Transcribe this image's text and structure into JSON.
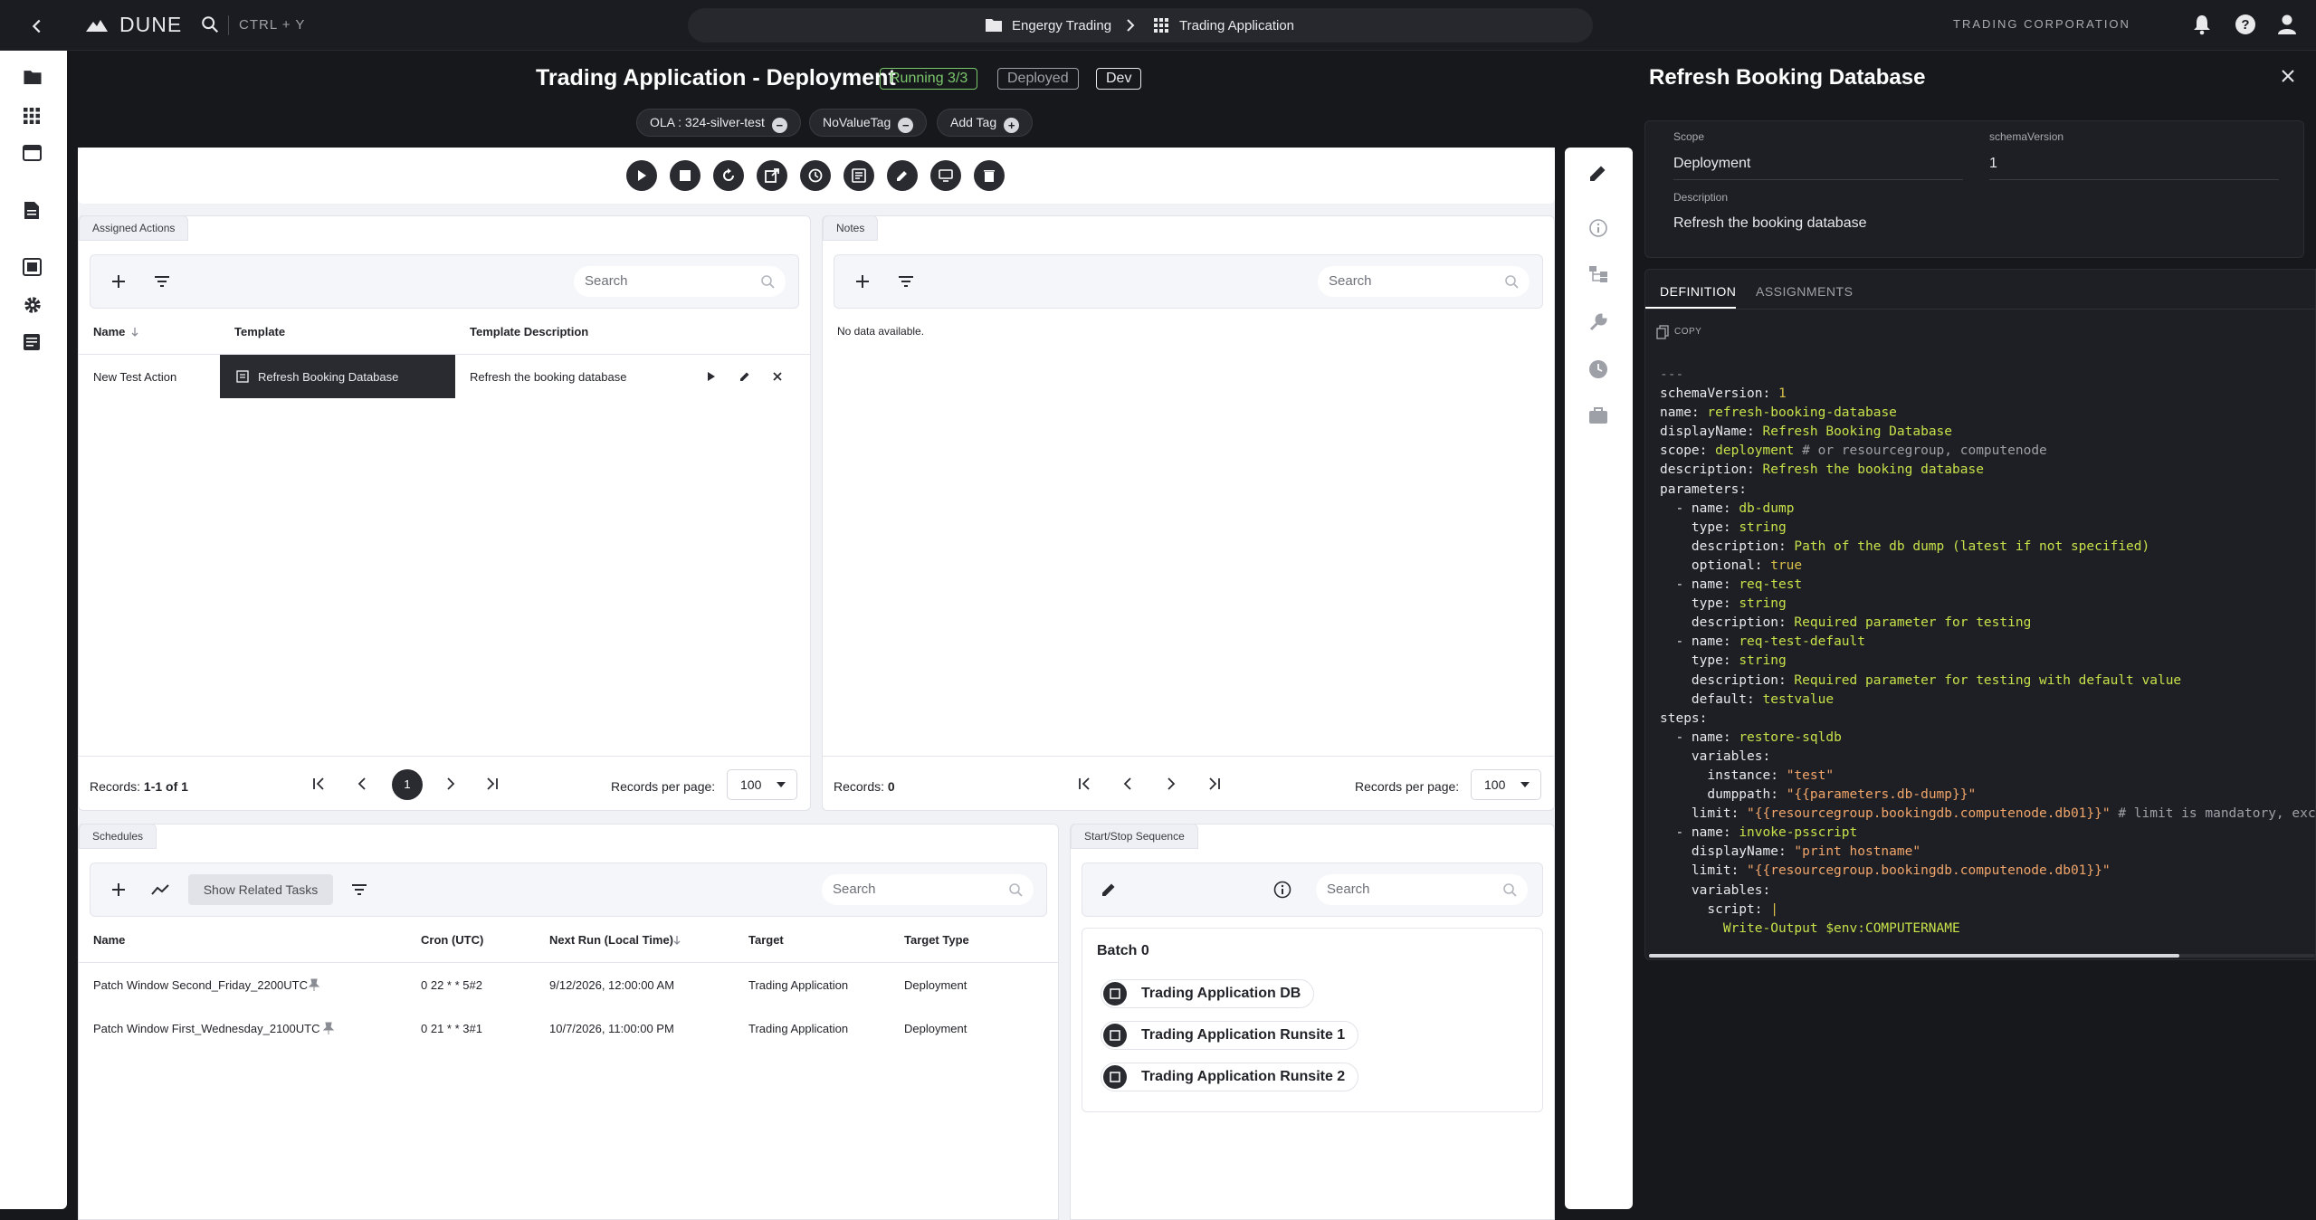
{
  "topbar": {
    "brand": "DUNE",
    "shortcut": "CTRL + Y",
    "breadcrumb": [
      "Engergy Trading",
      "Trading Application"
    ],
    "company": "TRADING CORPORATION"
  },
  "page": {
    "title": "Trading Application - Deployment",
    "badges": {
      "running": "Running 3/3",
      "deployed": "Deployed",
      "env": "Dev"
    },
    "tags": [
      "OLA : 324-silver-test",
      "NoValueTag",
      "Add Tag"
    ]
  },
  "assigned_actions": {
    "tab": "Assigned Actions",
    "search_placeholder": "Search",
    "columns": [
      "Name",
      "Template",
      "Template Description"
    ],
    "rows": [
      {
        "name": "New Test Action",
        "template": "Refresh Booking Database",
        "description": "Refresh the booking database"
      }
    ],
    "records_label": "Records:",
    "records_value": "1-1 of 1",
    "page": "1",
    "per_page_label": "Records per page:",
    "per_page": "100"
  },
  "notes": {
    "tab": "Notes",
    "search_placeholder": "Search",
    "empty": "No data available.",
    "records_label": "Records:",
    "records_value": "0",
    "per_page_label": "Records per page:",
    "per_page": "100"
  },
  "schedules": {
    "tab": "Schedules",
    "related_button": "Show Related Tasks",
    "search_placeholder": "Search",
    "columns": [
      "Name",
      "Cron (UTC)",
      "Next Run (Local Time)",
      "Target",
      "Target Type"
    ],
    "rows": [
      {
        "name": "Patch Window Second_Friday_2200UTC",
        "cron": "0 22 * * 5#2",
        "next": "9/12/2026, 12:00:00 AM",
        "target": "Trading Application",
        "type": "Deployment"
      },
      {
        "name": "Patch Window First_Wednesday_2100UTC",
        "cron": "0 21 * * 3#1",
        "next": "10/7/2026, 11:00:00 PM",
        "target": "Trading Application",
        "type": "Deployment"
      }
    ]
  },
  "sequence": {
    "tab": "Start/Stop Sequence",
    "search_placeholder": "Search",
    "batch": "Batch 0",
    "items": [
      "Trading Application DB",
      "Trading Application Runsite 1",
      "Trading Application Runsite 2"
    ]
  },
  "detail": {
    "title": "Refresh Booking Database",
    "scope_label": "Scope",
    "scope": "Deployment",
    "schema_label": "schemaVersion",
    "schema": "1",
    "desc_label": "Description",
    "desc": "Refresh the booking database",
    "tabs": [
      "DEFINITION",
      "ASSIGNMENTS"
    ],
    "copy": "COPY"
  },
  "colors": {
    "accent": "#9ac441",
    "running": "#7bc86c",
    "deployed": "#9ea0a8",
    "dark": "#17181c"
  }
}
